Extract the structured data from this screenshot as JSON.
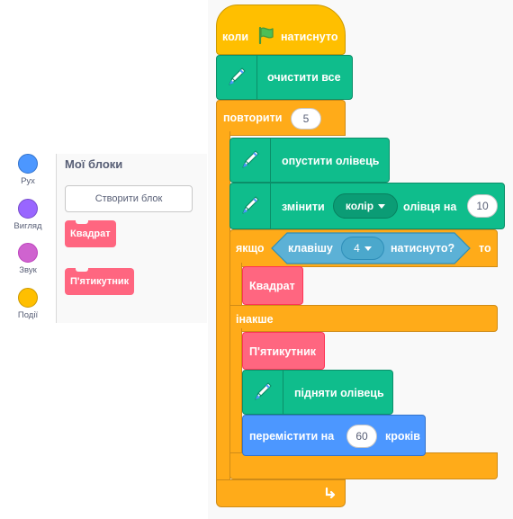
{
  "palette": {
    "categories": [
      {
        "label": "Рух",
        "color": "#4c97ff",
        "border": "#3373cc"
      },
      {
        "label": "Вигляд",
        "color": "#9966ff",
        "border": "#774dcb"
      },
      {
        "label": "Звук",
        "color": "#cf63cf",
        "border": "#bd42bd"
      },
      {
        "label": "Події",
        "color": "#ffbf00",
        "border": "#cc9900"
      }
    ],
    "title": "Мої блоки",
    "make_block_label": "Створити блок",
    "blocks": [
      "Квадрат",
      "П'ятикутник"
    ]
  },
  "script": {
    "hat_label_before": "коли",
    "hat_label_after": "натиснуто",
    "clear_label": "очистити все",
    "repeat_label": "повторити",
    "repeat_count": "5",
    "pen_down_label": "опустити олівець",
    "change_pen_label": "змінити",
    "change_pen_param": "колір",
    "change_pen_mid": "олівця на",
    "change_pen_value": "10",
    "if_label": "якщо",
    "then_label": "то",
    "key_label": "клавішу",
    "key_value": "4",
    "pressed_label": "натиснуто?",
    "call_square": "Квадрат",
    "else_label": "інакше",
    "call_pentagon": "П'ятикутник",
    "pen_up_label": "підняти олівець",
    "move_label": "перемістити на",
    "move_value": "60",
    "steps_label": "кроків"
  },
  "colors": {
    "events": "#ffbf00",
    "control": "#ffab19",
    "pen": "#0fbd8c",
    "motion": "#4c97ff",
    "my_blocks": "#ff6680",
    "sensing": "#5cb1d6"
  }
}
